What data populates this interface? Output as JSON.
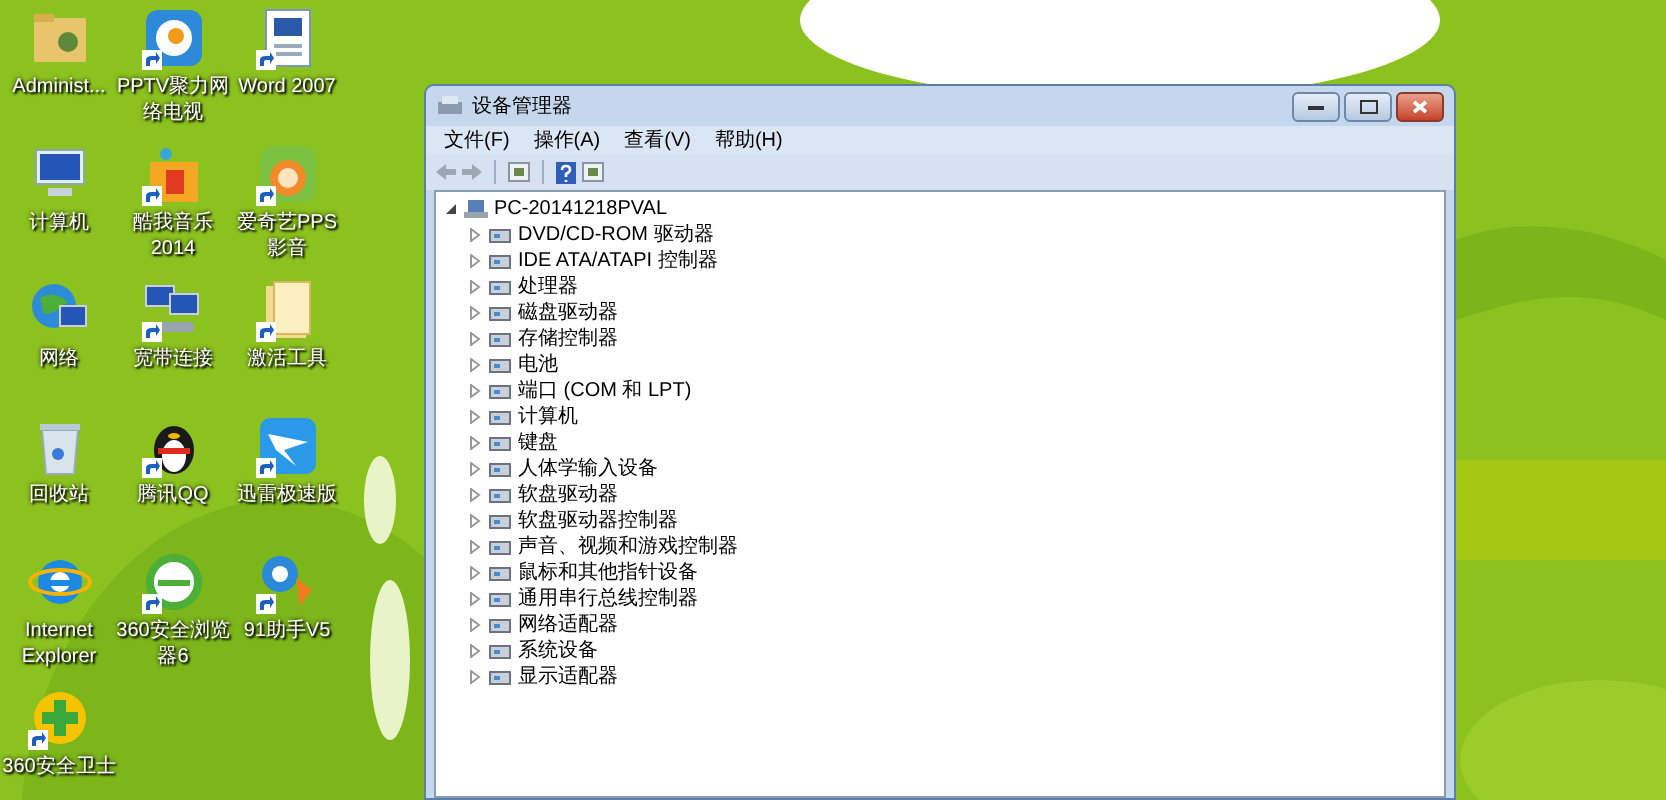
{
  "desktop": {
    "icons": [
      {
        "label": "Administ...",
        "shortcut": false
      },
      {
        "label": "PPTV聚力网络电视",
        "shortcut": true
      },
      {
        "label": "Word 2007",
        "shortcut": true
      },
      {
        "label": "计算机",
        "shortcut": false
      },
      {
        "label": "酷我音乐 2014",
        "shortcut": true
      },
      {
        "label": "爱奇艺PPS影音",
        "shortcut": true
      },
      {
        "label": "网络",
        "shortcut": false
      },
      {
        "label": "宽带连接",
        "shortcut": true
      },
      {
        "label": "激活工具",
        "shortcut": true
      },
      {
        "label": "回收站",
        "shortcut": false
      },
      {
        "label": "腾讯QQ",
        "shortcut": true
      },
      {
        "label": "迅雷极速版",
        "shortcut": true
      },
      {
        "label": "Internet Explorer",
        "shortcut": false
      },
      {
        "label": "360安全浏览器6",
        "shortcut": true
      },
      {
        "label": "91助手V5",
        "shortcut": true
      },
      {
        "label": "360安全卫士",
        "shortcut": true
      }
    ]
  },
  "window": {
    "title": "设备管理器",
    "menu": [
      "文件(F)",
      "操作(A)",
      "查看(V)",
      "帮助(H)"
    ],
    "tree": [
      {
        "label": "PC-20141218PVAL",
        "expanded": true,
        "children": [
          {
            "label": "DVD/CD-ROM 驱动器",
            "expanded": false
          },
          {
            "label": "IDE ATA/ATAPI 控制器",
            "expanded": false
          },
          {
            "label": "处理器",
            "expanded": false
          },
          {
            "label": "磁盘驱动器",
            "expanded": false
          },
          {
            "label": "存储控制器",
            "expanded": false
          },
          {
            "label": "电池",
            "expanded": false
          },
          {
            "label": "端口 (COM 和 LPT)",
            "expanded": false
          },
          {
            "label": "计算机",
            "expanded": false
          },
          {
            "label": "键盘",
            "expanded": false
          },
          {
            "label": "人体学输入设备",
            "expanded": false
          },
          {
            "label": "软盘驱动器",
            "expanded": false
          },
          {
            "label": "软盘驱动器控制器",
            "expanded": false
          },
          {
            "label": "声音、视频和游戏控制器",
            "expanded": false
          },
          {
            "label": "鼠标和其他指针设备",
            "expanded": false
          },
          {
            "label": "通用串行总线控制器",
            "expanded": false
          },
          {
            "label": "网络适配器",
            "expanded": false
          },
          {
            "label": "系统设备",
            "expanded": false
          },
          {
            "label": "显示适配器",
            "expanded": false
          }
        ]
      }
    ]
  }
}
